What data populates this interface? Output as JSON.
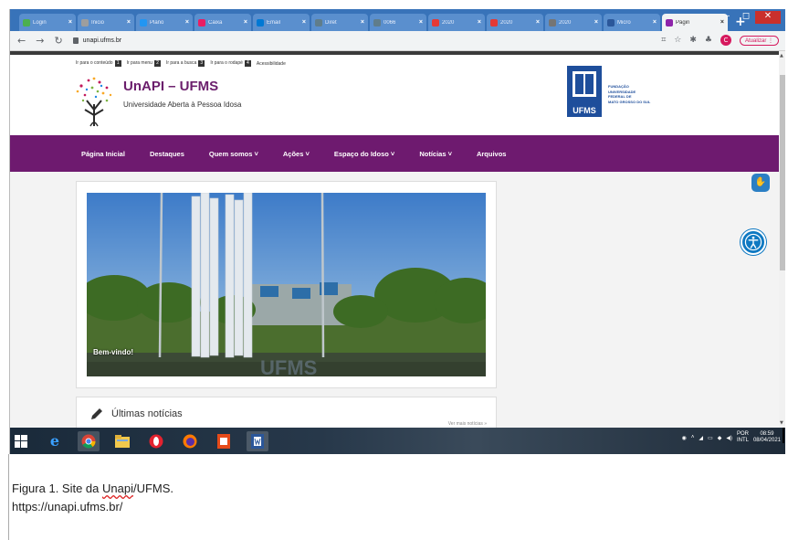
{
  "browser": {
    "tabs": [
      {
        "label": "Login",
        "color": "#4caf50"
      },
      {
        "label": "Inicio",
        "color": "#9e9e9e"
      },
      {
        "label": "Plano",
        "color": "#2196f3"
      },
      {
        "label": "Caixa",
        "color": "#e91e63"
      },
      {
        "label": "Email",
        "color": "#0078d4"
      },
      {
        "label": "Diret",
        "color": "#607d8b"
      },
      {
        "label": "0066",
        "color": "#607d8b"
      },
      {
        "label": "2020",
        "color": "#e53935"
      },
      {
        "label": "2020",
        "color": "#e53935"
      },
      {
        "label": "2020",
        "color": "#757575"
      },
      {
        "label": "Micro",
        "color": "#2b579a"
      },
      {
        "label": "Págin",
        "color": "#8e24aa",
        "active": true
      }
    ],
    "new_tab_symbol": "+",
    "window_controls": {
      "minimize": "–",
      "maximize": "◻",
      "close": "✕"
    },
    "url": "unapi.ufms.br",
    "profile_initial": "C",
    "update_label": "Atualizar"
  },
  "site": {
    "skip_links": [
      {
        "label": "Ir para o conteúdo",
        "key": "1"
      },
      {
        "label": "Ir para menu",
        "key": "2"
      },
      {
        "label": "Ir para a busca",
        "key": "3"
      },
      {
        "label": "Ir para o rodapé",
        "key": "4"
      },
      {
        "label": "Acessibilidade",
        "key": ""
      }
    ],
    "title": "UnAPI – UFMS",
    "subtitle": "Universidade Aberta à Pessoa Idosa",
    "ufms_logo_text": "UFMS",
    "ufms_lines": [
      "FUNDAÇÃO",
      "UNIVERSIDADE",
      "FEDERAL DE",
      "MATO GROSSO DO SUL"
    ],
    "nav": [
      "Página Inicial",
      "Destaques",
      "Quem somos ˅",
      "Ações ˅",
      "Espaço do Idoso ˅",
      "Notícias ˅",
      "Arquivos"
    ],
    "hero_caption": "Bem-vindo!",
    "hero_sign": "UFMS",
    "news_title": "Últimas notícias",
    "news_more": "Ver mais notícias »"
  },
  "taskbar": {
    "lang_top": "POR",
    "lang_bottom": "INTL",
    "time": "08:59",
    "date": "08/04/2021"
  },
  "figure": {
    "caption_prefix": "Figura 1. Site da ",
    "caption_word": "Unapi",
    "caption_suffix": "/UFMS.",
    "url": "https://unapi.ufms.br/"
  },
  "colors": {
    "brand_purple": "#6e1a6f",
    "title_purple": "#6b1e6c",
    "ufms_blue": "#1e4e9b",
    "browser_blue": "#3873b9"
  }
}
